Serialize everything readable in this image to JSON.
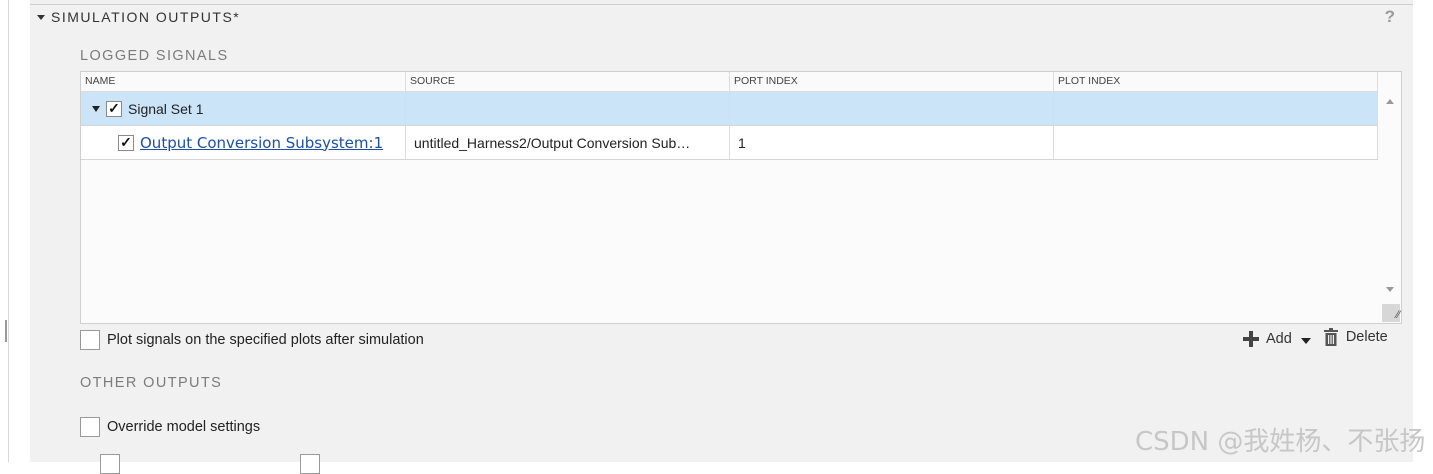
{
  "section": {
    "title": "SIMULATION OUTPUTS*",
    "help": "?"
  },
  "logged_signals": {
    "heading": "LOGGED SIGNALS",
    "columns": [
      "NAME",
      "SOURCE",
      "PORT INDEX",
      "PLOT INDEX"
    ],
    "group_row": {
      "name": "Signal Set 1",
      "checked": "✓",
      "source": "",
      "port_index": "",
      "plot_index": ""
    },
    "rows": [
      {
        "name": "Output Conversion Subsystem:1",
        "checked": "✓",
        "source": "untitled_Harness2/Output Conversion Sub…",
        "port_index": "1",
        "plot_index": ""
      }
    ],
    "plot_option_label": "Plot signals on the specified plots after simulation",
    "toolbar": {
      "add_label": "Add",
      "delete_label": "Delete"
    }
  },
  "other_outputs": {
    "heading": "OTHER OUTPUTS",
    "override_label": "Override model settings"
  },
  "watermark": "CSDN @我姓杨、不张扬",
  "colors": {
    "panel_bg": "#f1f1f1",
    "selected_row": "#cce4f7",
    "link": "#1c4fa6"
  }
}
